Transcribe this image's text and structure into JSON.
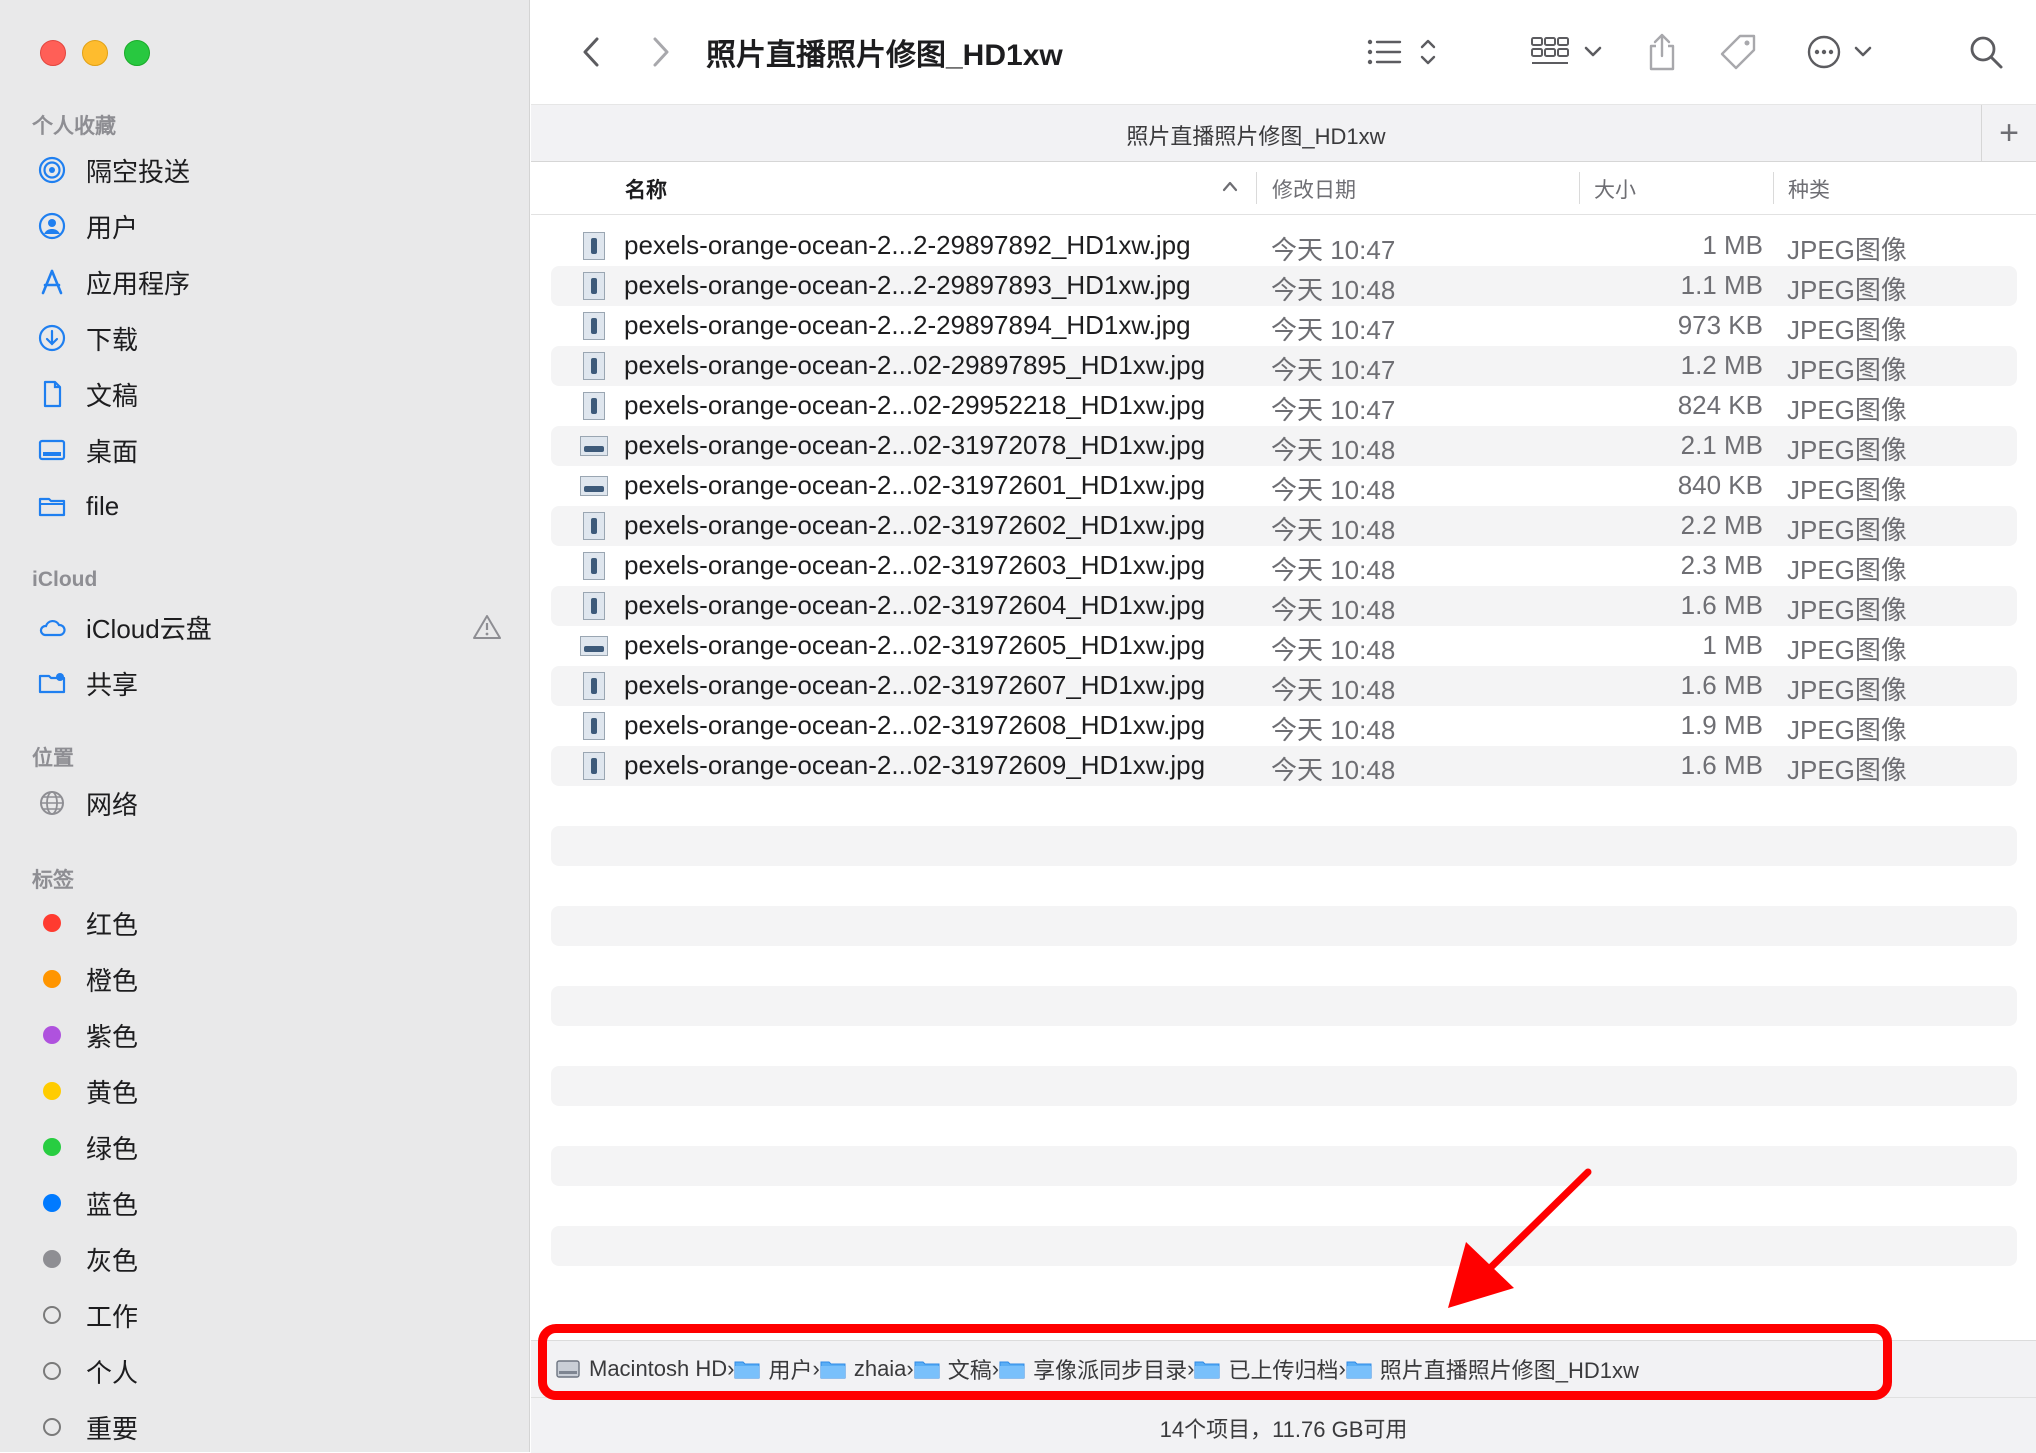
{
  "sidebar": {
    "favorites_title": "个人收藏",
    "favorites": [
      {
        "label": "隔空投送",
        "icon": "airdrop-icon"
      },
      {
        "label": "用户",
        "icon": "user-icon"
      },
      {
        "label": "应用程序",
        "icon": "applications-icon"
      },
      {
        "label": "下载",
        "icon": "download-icon"
      },
      {
        "label": "文稿",
        "icon": "document-icon"
      },
      {
        "label": "桌面",
        "icon": "desktop-icon"
      },
      {
        "label": "file",
        "icon": "folder-icon"
      }
    ],
    "icloud_title": "iCloud",
    "icloud": [
      {
        "label": "iCloud云盘",
        "icon": "cloud-icon"
      },
      {
        "label": "共享",
        "icon": "shared-folder-icon"
      }
    ],
    "locations_title": "位置",
    "locations": [
      {
        "label": "网络",
        "icon": "network-globe-icon"
      }
    ],
    "tags_title": "标签",
    "tags": [
      {
        "label": "红色",
        "color": "#ff3b30"
      },
      {
        "label": "橙色",
        "color": "#ff9500"
      },
      {
        "label": "紫色",
        "color": "#af52de"
      },
      {
        "label": "黄色",
        "color": "#ffcc00"
      },
      {
        "label": "绿色",
        "color": "#28cd41"
      },
      {
        "label": "蓝色",
        "color": "#007aff"
      },
      {
        "label": "灰色",
        "color": "#8e8e93"
      },
      {
        "label": "工作",
        "color": ""
      },
      {
        "label": "个人",
        "color": ""
      },
      {
        "label": "重要",
        "color": ""
      }
    ]
  },
  "toolbar": {
    "title": "照片直播照片修图_HD1xw"
  },
  "tab": {
    "title": "照片直播照片修图_HD1xw",
    "plus": "+"
  },
  "columns": {
    "name": "名称",
    "date": "修改日期",
    "size": "大小",
    "kind": "种类"
  },
  "files": [
    {
      "name": "pexels-orange-ocean-2...2-29897892_HD1xw.jpg",
      "date": "今天 10:47",
      "size": "1 MB",
      "kind": "JPEG图像",
      "thumb": "portrait"
    },
    {
      "name": "pexels-orange-ocean-2...2-29897893_HD1xw.jpg",
      "date": "今天 10:48",
      "size": "1.1 MB",
      "kind": "JPEG图像",
      "thumb": "portrait"
    },
    {
      "name": "pexels-orange-ocean-2...2-29897894_HD1xw.jpg",
      "date": "今天 10:47",
      "size": "973 KB",
      "kind": "JPEG图像",
      "thumb": "portrait"
    },
    {
      "name": "pexels-orange-ocean-2...02-29897895_HD1xw.jpg",
      "date": "今天 10:47",
      "size": "1.2 MB",
      "kind": "JPEG图像",
      "thumb": "portrait"
    },
    {
      "name": "pexels-orange-ocean-2...02-29952218_HD1xw.jpg",
      "date": "今天 10:47",
      "size": "824 KB",
      "kind": "JPEG图像",
      "thumb": "portrait"
    },
    {
      "name": "pexels-orange-ocean-2...02-31972078_HD1xw.jpg",
      "date": "今天 10:48",
      "size": "2.1 MB",
      "kind": "JPEG图像",
      "thumb": "wide"
    },
    {
      "name": "pexels-orange-ocean-2...02-31972601_HD1xw.jpg",
      "date": "今天 10:48",
      "size": "840 KB",
      "kind": "JPEG图像",
      "thumb": "wide"
    },
    {
      "name": "pexels-orange-ocean-2...02-31972602_HD1xw.jpg",
      "date": "今天 10:48",
      "size": "2.2 MB",
      "kind": "JPEG图像",
      "thumb": "portrait"
    },
    {
      "name": "pexels-orange-ocean-2...02-31972603_HD1xw.jpg",
      "date": "今天 10:48",
      "size": "2.3 MB",
      "kind": "JPEG图像",
      "thumb": "portrait"
    },
    {
      "name": "pexels-orange-ocean-2...02-31972604_HD1xw.jpg",
      "date": "今天 10:48",
      "size": "1.6 MB",
      "kind": "JPEG图像",
      "thumb": "portrait"
    },
    {
      "name": "pexels-orange-ocean-2...02-31972605_HD1xw.jpg",
      "date": "今天 10:48",
      "size": "1 MB",
      "kind": "JPEG图像",
      "thumb": "wide"
    },
    {
      "name": "pexels-orange-ocean-2...02-31972607_HD1xw.jpg",
      "date": "今天 10:48",
      "size": "1.6 MB",
      "kind": "JPEG图像",
      "thumb": "portrait"
    },
    {
      "name": "pexels-orange-ocean-2...02-31972608_HD1xw.jpg",
      "date": "今天 10:48",
      "size": "1.9 MB",
      "kind": "JPEG图像",
      "thumb": "portrait"
    },
    {
      "name": "pexels-orange-ocean-2...02-31972609_HD1xw.jpg",
      "date": "今天 10:48",
      "size": "1.6 MB",
      "kind": "JPEG图像",
      "thumb": "portrait"
    }
  ],
  "path": [
    {
      "label": "Macintosh HD",
      "icon": "hard-drive-icon"
    },
    {
      "label": "用户",
      "icon": "users-folder-icon"
    },
    {
      "label": "zhaia",
      "icon": "home-folder-icon"
    },
    {
      "label": "文稿",
      "icon": "documents-folder-icon"
    },
    {
      "label": "享像派同步目录",
      "icon": "folder-icon"
    },
    {
      "label": "已上传归档",
      "icon": "folder-icon"
    },
    {
      "label": "照片直播照片修图_HD1xw",
      "icon": "folder-icon"
    }
  ],
  "status": {
    "text": "14个项目，11.76 GB可用"
  },
  "colors": {
    "accent": "#1f7ff0",
    "highlight": "#ff0000"
  }
}
